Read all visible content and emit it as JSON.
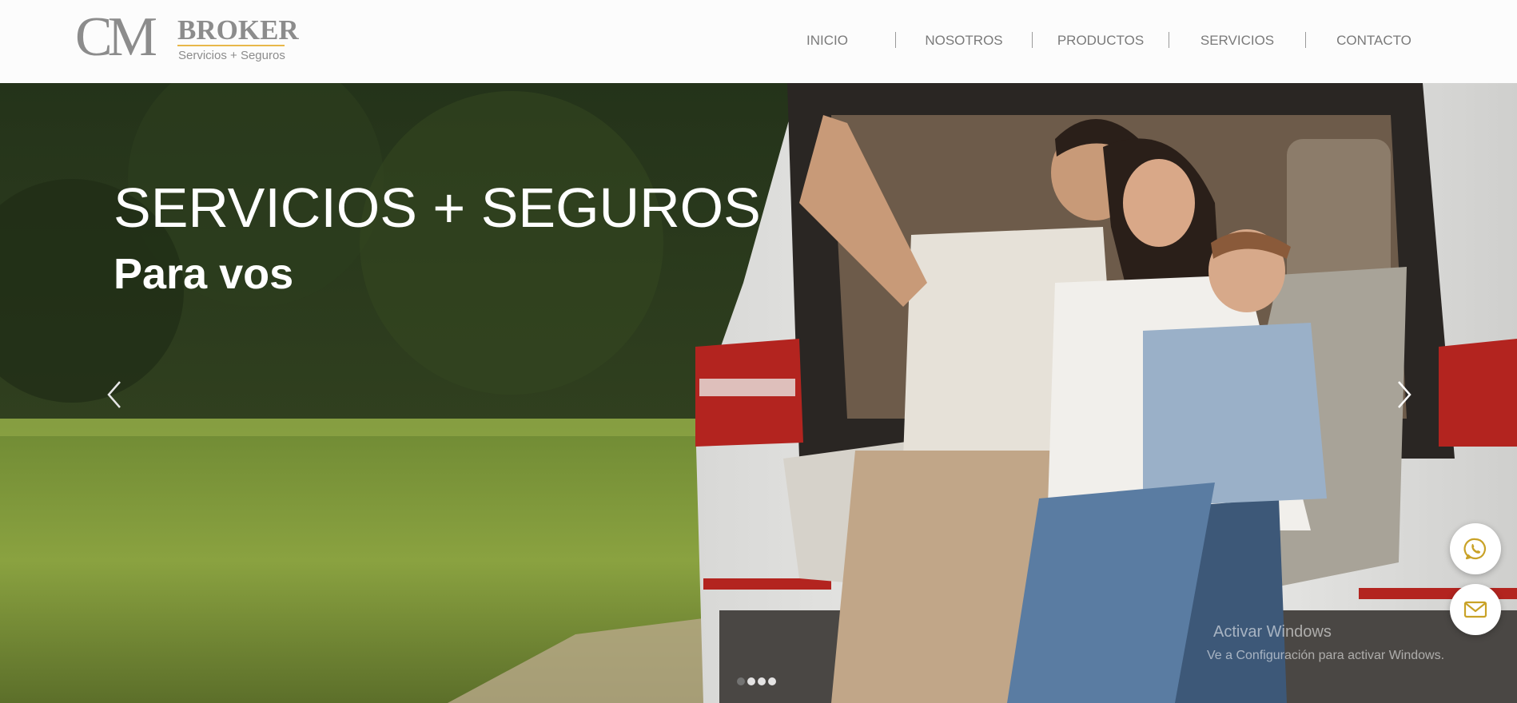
{
  "brand": {
    "logo_initials": "CM",
    "logo_name": "BROKER",
    "logo_tagline": "Servicios + Seguros",
    "accent_color": "#e8b84a",
    "logo_color": "#8c8c8c"
  },
  "nav": {
    "items": [
      {
        "label": "INICIO"
      },
      {
        "label": "NOSOTROS"
      },
      {
        "label": "PRODUCTOS"
      },
      {
        "label": "SERVICIOS"
      },
      {
        "label": "CONTACTO"
      }
    ]
  },
  "hero": {
    "title": "SERVICIOS + SEGUROS",
    "subtitle": "Para vos",
    "prev_icon": "chevron-left-icon",
    "next_icon": "chevron-right-icon",
    "slide_count": 4,
    "active_slide": 1
  },
  "floating": {
    "whatsapp_icon": "whatsapp-icon",
    "email_icon": "mail-icon"
  },
  "watermark": {
    "title": "Activar Windows",
    "subtitle": "Ve a Configuración para activar Windows."
  }
}
